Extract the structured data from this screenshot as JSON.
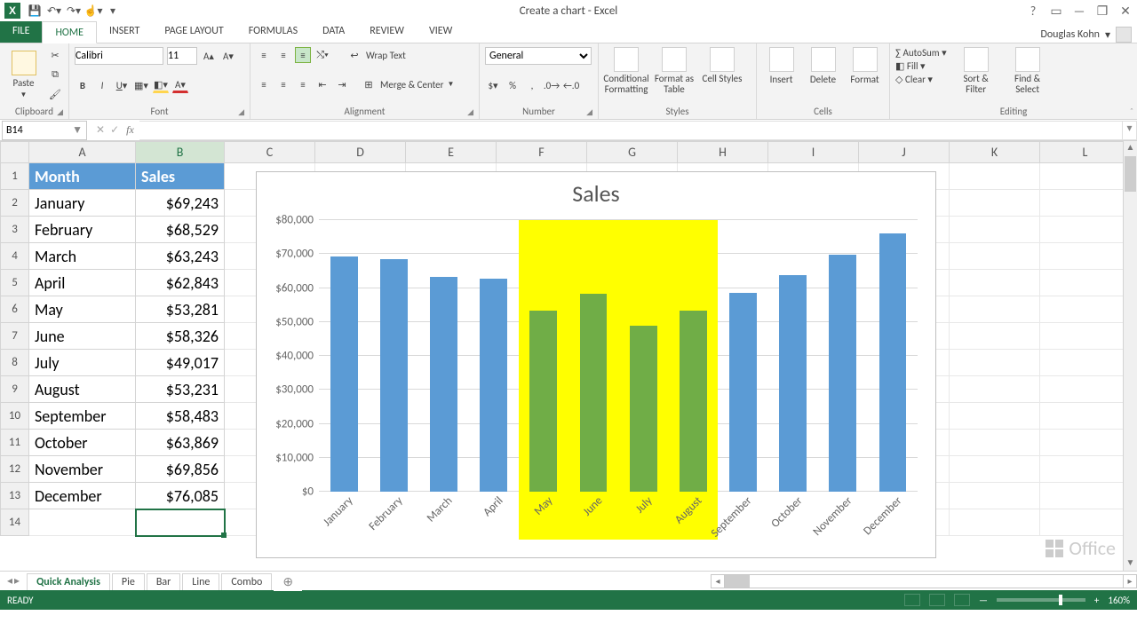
{
  "title": "Create a chart - Excel",
  "user": "Douglas Kohn",
  "tabs": {
    "file": "FILE",
    "list": [
      "HOME",
      "INSERT",
      "PAGE LAYOUT",
      "FORMULAS",
      "DATA",
      "REVIEW",
      "VIEW"
    ],
    "active": 0
  },
  "ribbon": {
    "clipboard": {
      "label": "Clipboard",
      "paste": "Paste"
    },
    "font": {
      "label": "Font",
      "name": "Calibri",
      "size": "11"
    },
    "alignment": {
      "label": "Alignment",
      "wrap": "Wrap Text",
      "merge": "Merge & Center"
    },
    "number": {
      "label": "Number",
      "format": "General"
    },
    "styles": {
      "label": "Styles",
      "cond": "Conditional Formatting",
      "table": "Format as Table",
      "cell": "Cell Styles"
    },
    "cells": {
      "label": "Cells",
      "insert": "Insert",
      "delete": "Delete",
      "format": "Format"
    },
    "editing": {
      "label": "Editing",
      "autosum": "AutoSum",
      "fill": "Fill",
      "clear": "Clear",
      "sort": "Sort & Filter",
      "find": "Find & Select"
    }
  },
  "namebox": "B14",
  "columns": [
    "A",
    "B",
    "C",
    "D",
    "E",
    "F",
    "G",
    "H",
    "I",
    "J",
    "K",
    "L"
  ],
  "headers": {
    "A": "Month",
    "B": "Sales"
  },
  "rows": [
    {
      "r": 1,
      "A": "Month",
      "B": "Sales",
      "hdr": true
    },
    {
      "r": 2,
      "A": "January",
      "B": "$69,243"
    },
    {
      "r": 3,
      "A": "February",
      "B": "$68,529"
    },
    {
      "r": 4,
      "A": "March",
      "B": "$63,243"
    },
    {
      "r": 5,
      "A": "April",
      "B": "$62,843"
    },
    {
      "r": 6,
      "A": "May",
      "B": "$53,281"
    },
    {
      "r": 7,
      "A": "June",
      "B": "$58,326"
    },
    {
      "r": 8,
      "A": "July",
      "B": "$49,017"
    },
    {
      "r": 9,
      "A": "August",
      "B": "$53,231"
    },
    {
      "r": 10,
      "A": "September",
      "B": "$58,483"
    },
    {
      "r": 11,
      "A": "October",
      "B": "$63,869"
    },
    {
      "r": 12,
      "A": "November",
      "B": "$69,856"
    },
    {
      "r": 13,
      "A": "December",
      "B": "$76,085"
    }
  ],
  "selected_row": 14,
  "chart_data": {
    "type": "bar",
    "title": "Sales",
    "categories": [
      "January",
      "February",
      "March",
      "April",
      "May",
      "June",
      "July",
      "August",
      "September",
      "October",
      "November",
      "December"
    ],
    "values": [
      69243,
      68529,
      63243,
      62843,
      53281,
      58326,
      49017,
      53231,
      58483,
      63869,
      69856,
      76085
    ],
    "highlight_idx": [
      4,
      5,
      6,
      7
    ],
    "ylim": [
      0,
      80000
    ],
    "yticks": [
      "$0",
      "$10,000",
      "$20,000",
      "$30,000",
      "$40,000",
      "$50,000",
      "$60,000",
      "$70,000",
      "$80,000"
    ]
  },
  "worksheets": [
    "Quick Analysis",
    "Pie",
    "Bar",
    "Line",
    "Combo"
  ],
  "active_ws": 0,
  "status": {
    "ready": "READY",
    "zoom": "160%"
  },
  "office_mark": "Office"
}
